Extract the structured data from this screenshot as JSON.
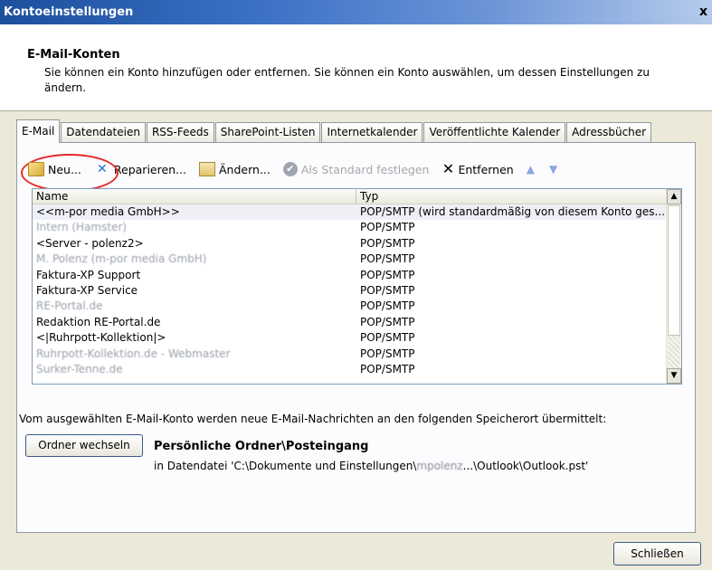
{
  "window": {
    "title": "Kontoeinstellungen",
    "close_glyph": "x"
  },
  "header": {
    "title": "E-Mail-Konten",
    "description": "Sie können ein Konto hinzufügen oder entfernen. Sie können ein Konto auswählen, um dessen Einstellungen zu ändern."
  },
  "tabs": [
    {
      "label": "E-Mail",
      "active": true
    },
    {
      "label": "Datendateien",
      "active": false
    },
    {
      "label": "RSS-Feeds",
      "active": false
    },
    {
      "label": "SharePoint-Listen",
      "active": false
    },
    {
      "label": "Internetkalender",
      "active": false
    },
    {
      "label": "Veröffentlichte Kalender",
      "active": false
    },
    {
      "label": "Adressbücher",
      "active": false
    }
  ],
  "toolbar": {
    "new_label": "Neu...",
    "repair_label": "Reparieren...",
    "change_label": "Ändern...",
    "default_label": "Als Standard festlegen",
    "remove_label": "Entfernen",
    "up_glyph": "▲",
    "down_glyph": "▼",
    "annotation_color": "#e62a2a"
  },
  "accounts": {
    "headers": {
      "name": "Name",
      "type": "Typ"
    },
    "rows": [
      {
        "name": "<<m-por media GmbH>>",
        "type": "POP/SMTP (wird standardmäßig von diesem Konto ges...",
        "selected": true,
        "blurred": false
      },
      {
        "name": "Intern (Hamster)",
        "type": "POP/SMTP",
        "selected": false,
        "blurred": true
      },
      {
        "name": "<Server - polenz2>",
        "type": "POP/SMTP",
        "selected": false,
        "blurred": false
      },
      {
        "name": "M. Polenz (m-por media GmbH)",
        "type": "POP/SMTP",
        "selected": false,
        "blurred": true
      },
      {
        "name": "Faktura-XP Support",
        "type": "POP/SMTP",
        "selected": false,
        "blurred": false
      },
      {
        "name": "Faktura-XP Service",
        "type": "POP/SMTP",
        "selected": false,
        "blurred": false
      },
      {
        "name": "RE-Portal.de",
        "type": "POP/SMTP",
        "selected": false,
        "blurred": true
      },
      {
        "name": "Redaktion RE-Portal.de",
        "type": "POP/SMTP",
        "selected": false,
        "blurred": false
      },
      {
        "name": "<|Ruhrpott-Kollektion|>",
        "type": "POP/SMTP",
        "selected": false,
        "blurred": false
      },
      {
        "name": "Ruhrpott-Kollektion.de - Webmaster",
        "type": "POP/SMTP",
        "selected": false,
        "blurred": true
      },
      {
        "name": "Surker-Tenne.de",
        "type": "POP/SMTP",
        "selected": false,
        "blurred": true
      }
    ],
    "scroll_up_glyph": "▲",
    "scroll_down_glyph": "▼"
  },
  "storage": {
    "description": "Vom ausgewählten E-Mail-Konto werden neue E-Mail-Nachrichten an den folgenden Speicherort übermittelt:",
    "change_folder_label": "Ordner wechseln",
    "path": "Persönliche Ordner\\Posteingang",
    "file_prefix": "in Datendatei 'C:\\Dokumente und Einstellungen\\",
    "file_user": "mpolenz",
    "file_suffix": "...\\Outlook\\Outlook.pst'"
  },
  "footer": {
    "close_label": "Schließen"
  }
}
